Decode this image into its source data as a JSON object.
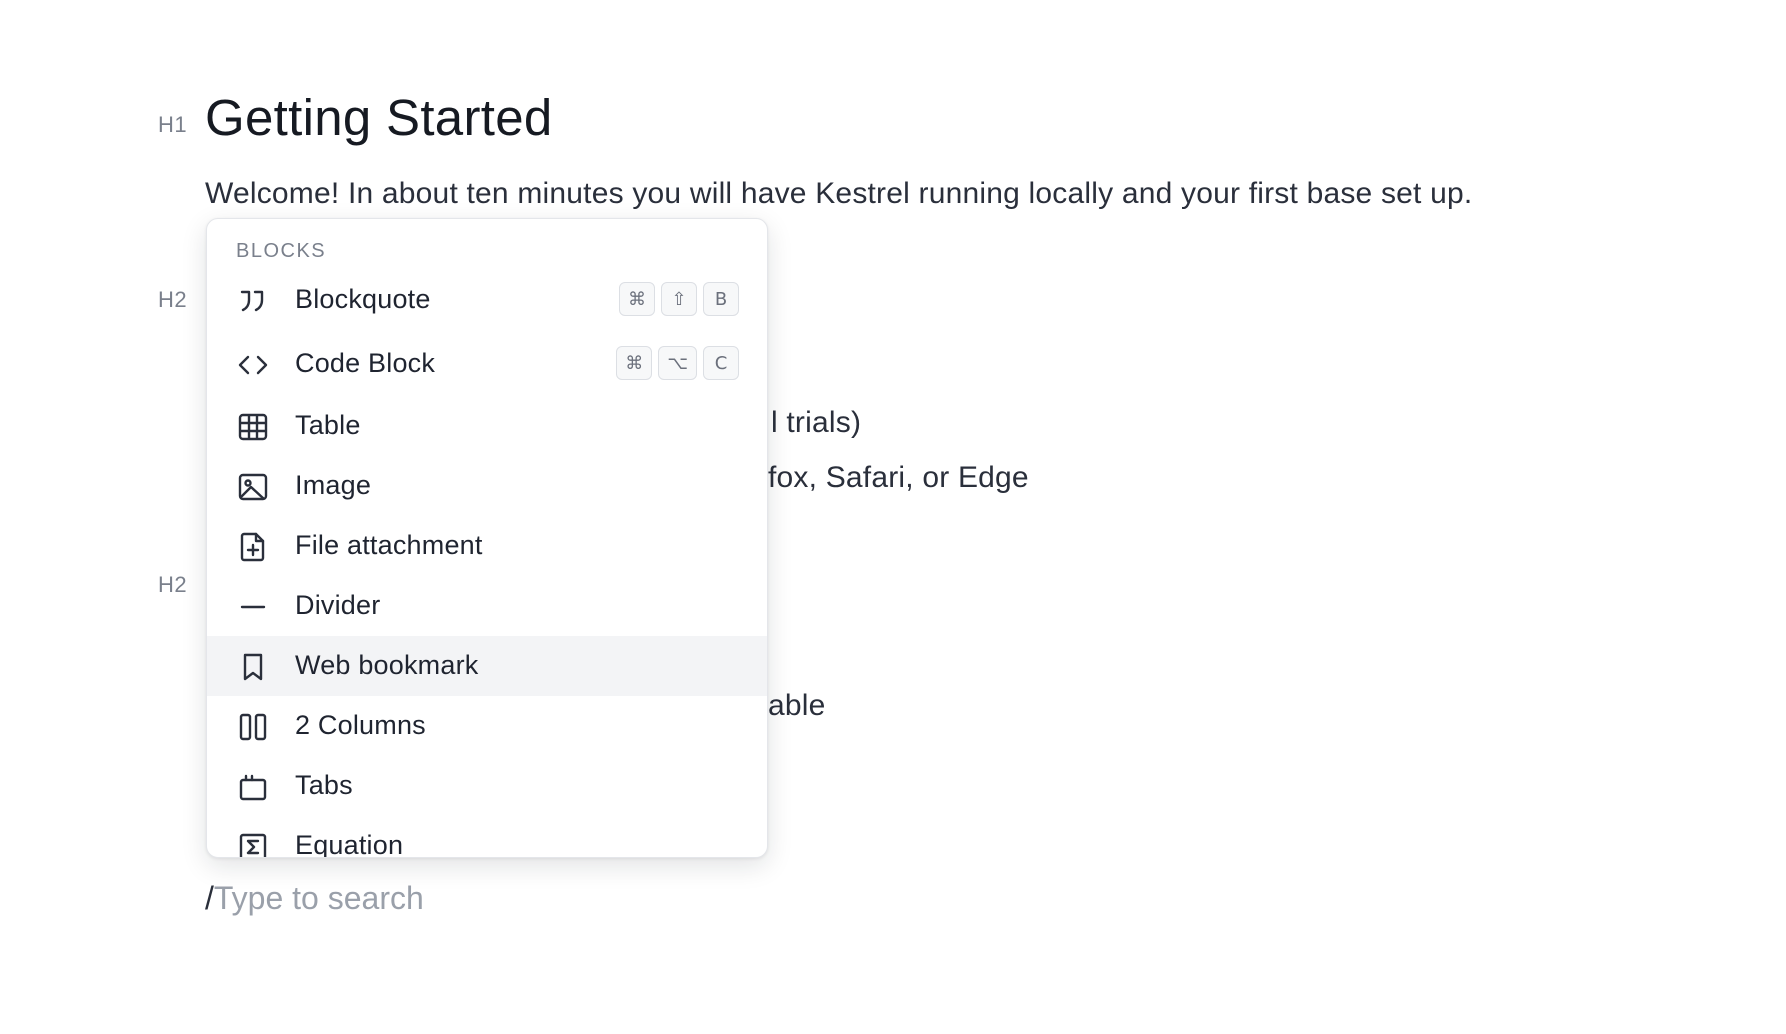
{
  "editor": {
    "h1_marker": "H1",
    "title": "Getting Started",
    "intro": "Welcome! In about ten minutes you will have Kestrel running locally and your first base set up.",
    "h2_marker_1": "H2",
    "h2_marker_2": "H2",
    "partial_1": "l trials)",
    "partial_2": "fox, Safari, or Edge",
    "partial_3": "able",
    "slash": "/",
    "search_placeholder": "Type to search"
  },
  "menu": {
    "header": "BLOCKS",
    "items": [
      {
        "label": "Blockquote",
        "icon": "blockquote-icon",
        "keys": [
          "⌘",
          "⇧",
          "B"
        ]
      },
      {
        "label": "Code Block",
        "icon": "code-icon",
        "keys": [
          "⌘",
          "⌥",
          "C"
        ]
      },
      {
        "label": "Table",
        "icon": "table-icon"
      },
      {
        "label": "Image",
        "icon": "image-icon"
      },
      {
        "label": "File attachment",
        "icon": "file-plus-icon"
      },
      {
        "label": "Divider",
        "icon": "divider-icon"
      },
      {
        "label": "Web bookmark",
        "icon": "bookmark-icon",
        "active": true
      },
      {
        "label": "2 Columns",
        "icon": "columns-icon"
      },
      {
        "label": "Tabs",
        "icon": "tabs-icon"
      },
      {
        "label": "Equation",
        "icon": "equation-icon"
      }
    ]
  }
}
